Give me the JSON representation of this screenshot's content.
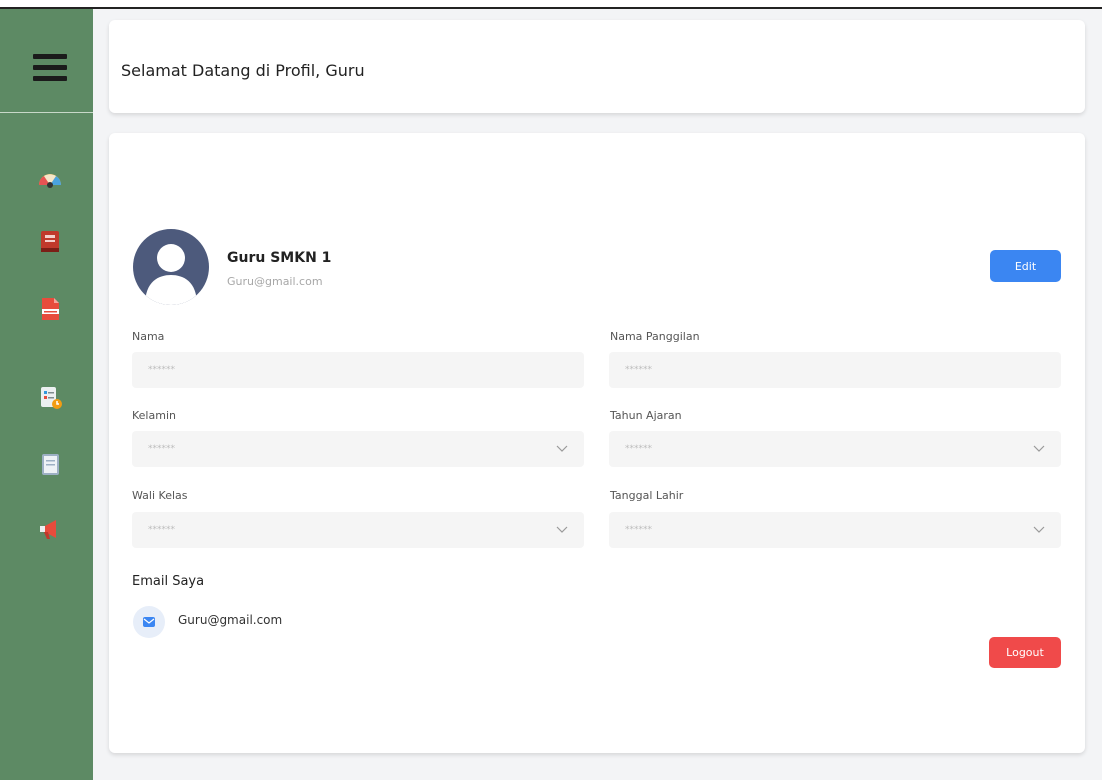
{
  "header": {
    "title": "Selamat Datang di Profil, Guru"
  },
  "sidebar": {
    "icons": [
      "dashboard-gauge-icon",
      "book-icon",
      "ebook-icon",
      "task-list-icon",
      "document-icon",
      "megaphone-icon"
    ]
  },
  "profile": {
    "name": "Guru SMKN 1",
    "email": "Guru@gmail.com",
    "edit_label": "Edit"
  },
  "form": {
    "nama": {
      "label": "Nama",
      "value": "******"
    },
    "nama_panggilan": {
      "label": "Nama Panggilan",
      "value": "******"
    },
    "kelamin": {
      "label": "Kelamin",
      "value": "******"
    },
    "tahun_ajaran": {
      "label": "Tahun Ajaran",
      "value": "******"
    },
    "wali_kelas": {
      "label": "Wali Kelas",
      "value": "******"
    },
    "tanggal_lahir": {
      "label": "Tanggal Lahir",
      "value": "******"
    }
  },
  "email_section": {
    "title": "Email Saya",
    "address": "Guru@gmail.com"
  },
  "logout_label": "Logout",
  "colors": {
    "sidebar": "#5d8a64",
    "edit_button": "#3b86f2",
    "logout_button": "#f04a4a"
  }
}
